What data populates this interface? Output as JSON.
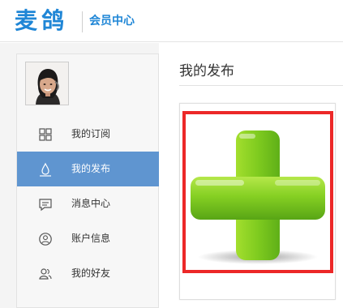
{
  "header": {
    "logo_text": "麦鸽",
    "subtitle": "会员中心"
  },
  "sidebar": {
    "items": [
      {
        "label": "我的订阅",
        "icon": "grid-icon",
        "active": false
      },
      {
        "label": "我的发布",
        "icon": "water-drop-icon",
        "active": true
      },
      {
        "label": "消息中心",
        "icon": "message-icon",
        "active": false
      },
      {
        "label": "账户信息",
        "icon": "account-icon",
        "active": false
      },
      {
        "label": "我的好友",
        "icon": "friends-icon",
        "active": false
      }
    ]
  },
  "main": {
    "title": "我的发布"
  },
  "colors": {
    "brand_blue": "#1f86d6",
    "active_nav": "#5f95d0",
    "highlight_red": "#ec2828",
    "plus_green": "#6fc21e"
  }
}
